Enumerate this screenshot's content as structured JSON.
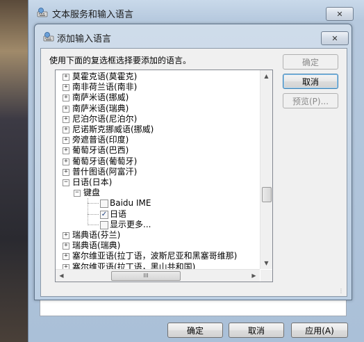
{
  "outer_window": {
    "title": "文本服务和输入语言",
    "close_glyph": "✕",
    "buttons": {
      "ok": "确定",
      "cancel": "取消",
      "apply": "应用(A)"
    }
  },
  "dialog": {
    "title": "添加输入语言",
    "close_glyph": "✕",
    "instruction": "使用下面的复选框选择要添加的语言。",
    "buttons": {
      "ok": "确定",
      "cancel": "取消",
      "preview": "预览(P)..."
    }
  },
  "tree": {
    "items": [
      {
        "label": "莫霍克语(莫霍克)",
        "level": 0,
        "expander": "+"
      },
      {
        "label": "南非荷兰语(南非)",
        "level": 0,
        "expander": "+"
      },
      {
        "label": "南萨米语(挪威)",
        "level": 0,
        "expander": "+"
      },
      {
        "label": "南萨米语(瑞典)",
        "level": 0,
        "expander": "+"
      },
      {
        "label": "尼泊尔语(尼泊尔)",
        "level": 0,
        "expander": "+"
      },
      {
        "label": "尼诺斯克挪威语(挪威)",
        "level": 0,
        "expander": "+"
      },
      {
        "label": "旁遮普语(印度)",
        "level": 0,
        "expander": "+"
      },
      {
        "label": "葡萄牙语(巴西)",
        "level": 0,
        "expander": "+"
      },
      {
        "label": "葡萄牙语(葡萄牙)",
        "level": 0,
        "expander": "+"
      },
      {
        "label": "普什图语(阿富汗)",
        "level": 0,
        "expander": "+"
      },
      {
        "label": "日语(日本)",
        "level": 0,
        "expander": "−"
      },
      {
        "label": "键盘",
        "level": 1,
        "expander": "−"
      },
      {
        "label": "Baidu IME",
        "level": 2,
        "checked": false
      },
      {
        "label": "日语",
        "level": 2,
        "checked": true
      },
      {
        "label": "显示更多...",
        "level": 2,
        "checked": false
      },
      {
        "label": "瑞典语(芬兰)",
        "level": 0,
        "expander": "+"
      },
      {
        "label": "瑞典语(瑞典)",
        "level": 0,
        "expander": "+"
      },
      {
        "label": "塞尔维亚语(拉丁语，波斯尼亚和黑塞哥维那)",
        "level": 0,
        "expander": "+"
      },
      {
        "label": "塞尔维亚语(拉丁语，黑山共和国)",
        "level": 0,
        "expander": "+"
      }
    ],
    "check_glyph": "✓",
    "scroll": {
      "up": "▲",
      "down": "▼",
      "left": "◀",
      "right": "▶",
      "grip": "⋮",
      "hgrip": "III"
    }
  },
  "colors": {
    "title_blue": "#b6c9de",
    "focus_border": "#3c7fb1"
  }
}
